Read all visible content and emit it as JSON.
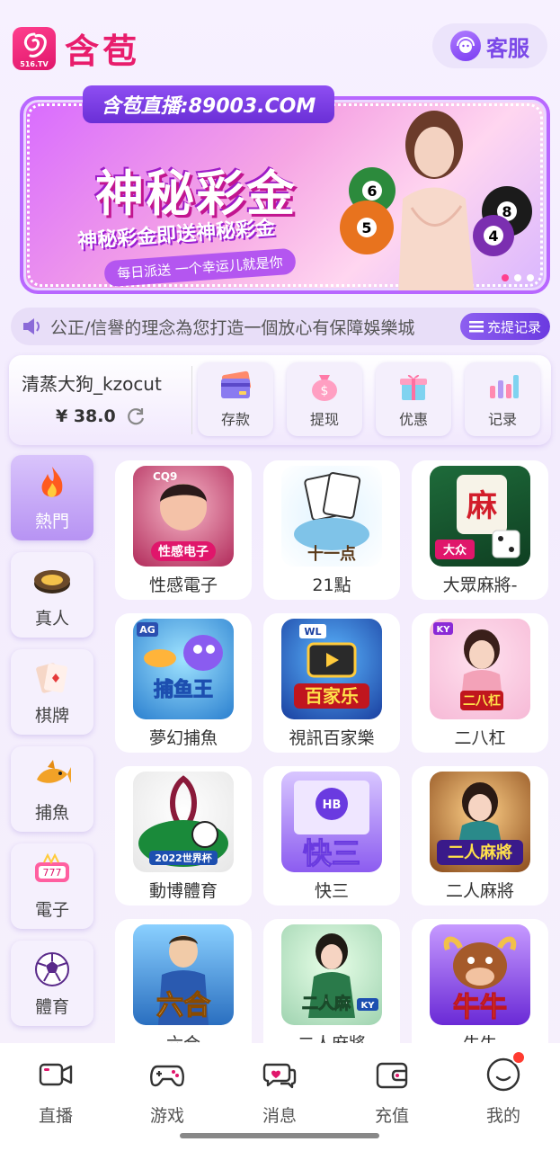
{
  "header": {
    "logo_sub": "516.TV",
    "logo_text": "含苞",
    "service_label": "客服"
  },
  "banner": {
    "tab_text": "含苞直播:89003.COM",
    "title": "神秘彩金",
    "subtitle": "神秘彩金即送神秘彩金",
    "small_text": "每日派送 一个幸运儿就是你",
    "ball_numbers": [
      "6",
      "5",
      "8",
      "4"
    ],
    "slide_count": 3,
    "active_slide": 1
  },
  "marquee": {
    "text": "公正/信譽的理念為您打造一個放心有保障娛樂城",
    "record_label": "充提记录"
  },
  "wallet": {
    "username": "清蒸大狗_kzocut",
    "balance": "¥ 38.0",
    "buttons": [
      "存款",
      "提现",
      "优惠",
      "记录"
    ]
  },
  "categories": [
    {
      "label": "熱門",
      "icon": "flame-icon",
      "active": true
    },
    {
      "label": "真人",
      "icon": "poker-chip-icon",
      "active": false
    },
    {
      "label": "棋牌",
      "icon": "playing-cards-icon",
      "active": false
    },
    {
      "label": "捕魚",
      "icon": "shark-icon",
      "active": false
    },
    {
      "label": "電子",
      "icon": "slot-icon",
      "active": false
    },
    {
      "label": "體育",
      "icon": "soccer-ball-icon",
      "active": false
    }
  ],
  "games": [
    {
      "label": "性感電子",
      "thumb_text": "性感电子",
      "thumb_tag": "CQ9"
    },
    {
      "label": "21點",
      "thumb_text": "十一点",
      "thumb_tag": ""
    },
    {
      "label": "大眾麻將-",
      "thumb_text": "麻",
      "thumb_tag": "大众"
    },
    {
      "label": "夢幻捕魚",
      "thumb_text": "捕鱼王",
      "thumb_tag": "AG"
    },
    {
      "label": "視訊百家樂",
      "thumb_text": "百家乐",
      "thumb_tag": "WL"
    },
    {
      "label": "二八杠",
      "thumb_text": "二八杠",
      "thumb_tag": "KY"
    },
    {
      "label": "動博體育",
      "thumb_text": "2022世界杯",
      "thumb_tag": ""
    },
    {
      "label": "快三",
      "thumb_text": "快三",
      "thumb_tag": "HB"
    },
    {
      "label": "二人麻將",
      "thumb_text": "二人麻將",
      "thumb_tag": ""
    },
    {
      "label": "六合",
      "thumb_text": "六合",
      "thumb_tag": ""
    },
    {
      "label": "二人麻將",
      "thumb_text": "二人麻",
      "thumb_tag": "KY"
    },
    {
      "label": "牛牛",
      "thumb_text": "牛牛",
      "thumb_tag": ""
    }
  ],
  "bottom_nav": [
    {
      "label": "直播",
      "icon": "video-camera-icon"
    },
    {
      "label": "游戏",
      "icon": "gamepad-icon"
    },
    {
      "label": "消息",
      "icon": "chat-bubble-icon"
    },
    {
      "label": "充值",
      "icon": "wallet-icon"
    },
    {
      "label": "我的",
      "icon": "smile-face-icon"
    }
  ],
  "colors": {
    "brand_pink": "#e81d6c",
    "accent_purple": "#7b49e8",
    "badge_red": "#ff3b30"
  }
}
